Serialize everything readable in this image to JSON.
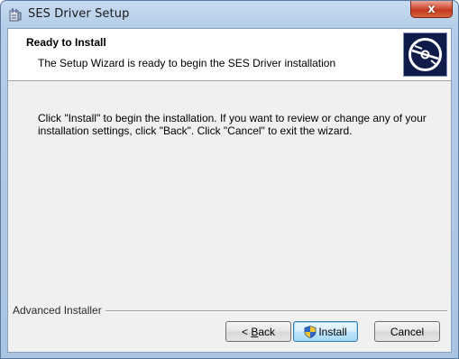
{
  "window": {
    "title": "SES Driver Setup",
    "close_glyph": "x",
    "icons": {
      "app": "setup-package-icon",
      "close": "close-icon"
    }
  },
  "banner": {
    "title": "Ready to Install",
    "subtitle": "The Setup Wizard is ready to begin the SES Driver installation",
    "logo_icon": "disc-icon",
    "logo_bg_color": "#0f1c4a"
  },
  "body": {
    "line1": "Click \"Install\" to begin the installation.  If you want to review or change any of your",
    "line2": "installation settings, click \"Back\".  Click \"Cancel\" to exit the wizard."
  },
  "footer": {
    "brand": "Advanced Installer"
  },
  "buttons": {
    "back": {
      "prefix": "< ",
      "mnemonic": "B",
      "rest": "ack"
    },
    "install": {
      "label": "Install",
      "icon": "uac-shield-icon"
    },
    "cancel": {
      "label": "Cancel"
    }
  }
}
